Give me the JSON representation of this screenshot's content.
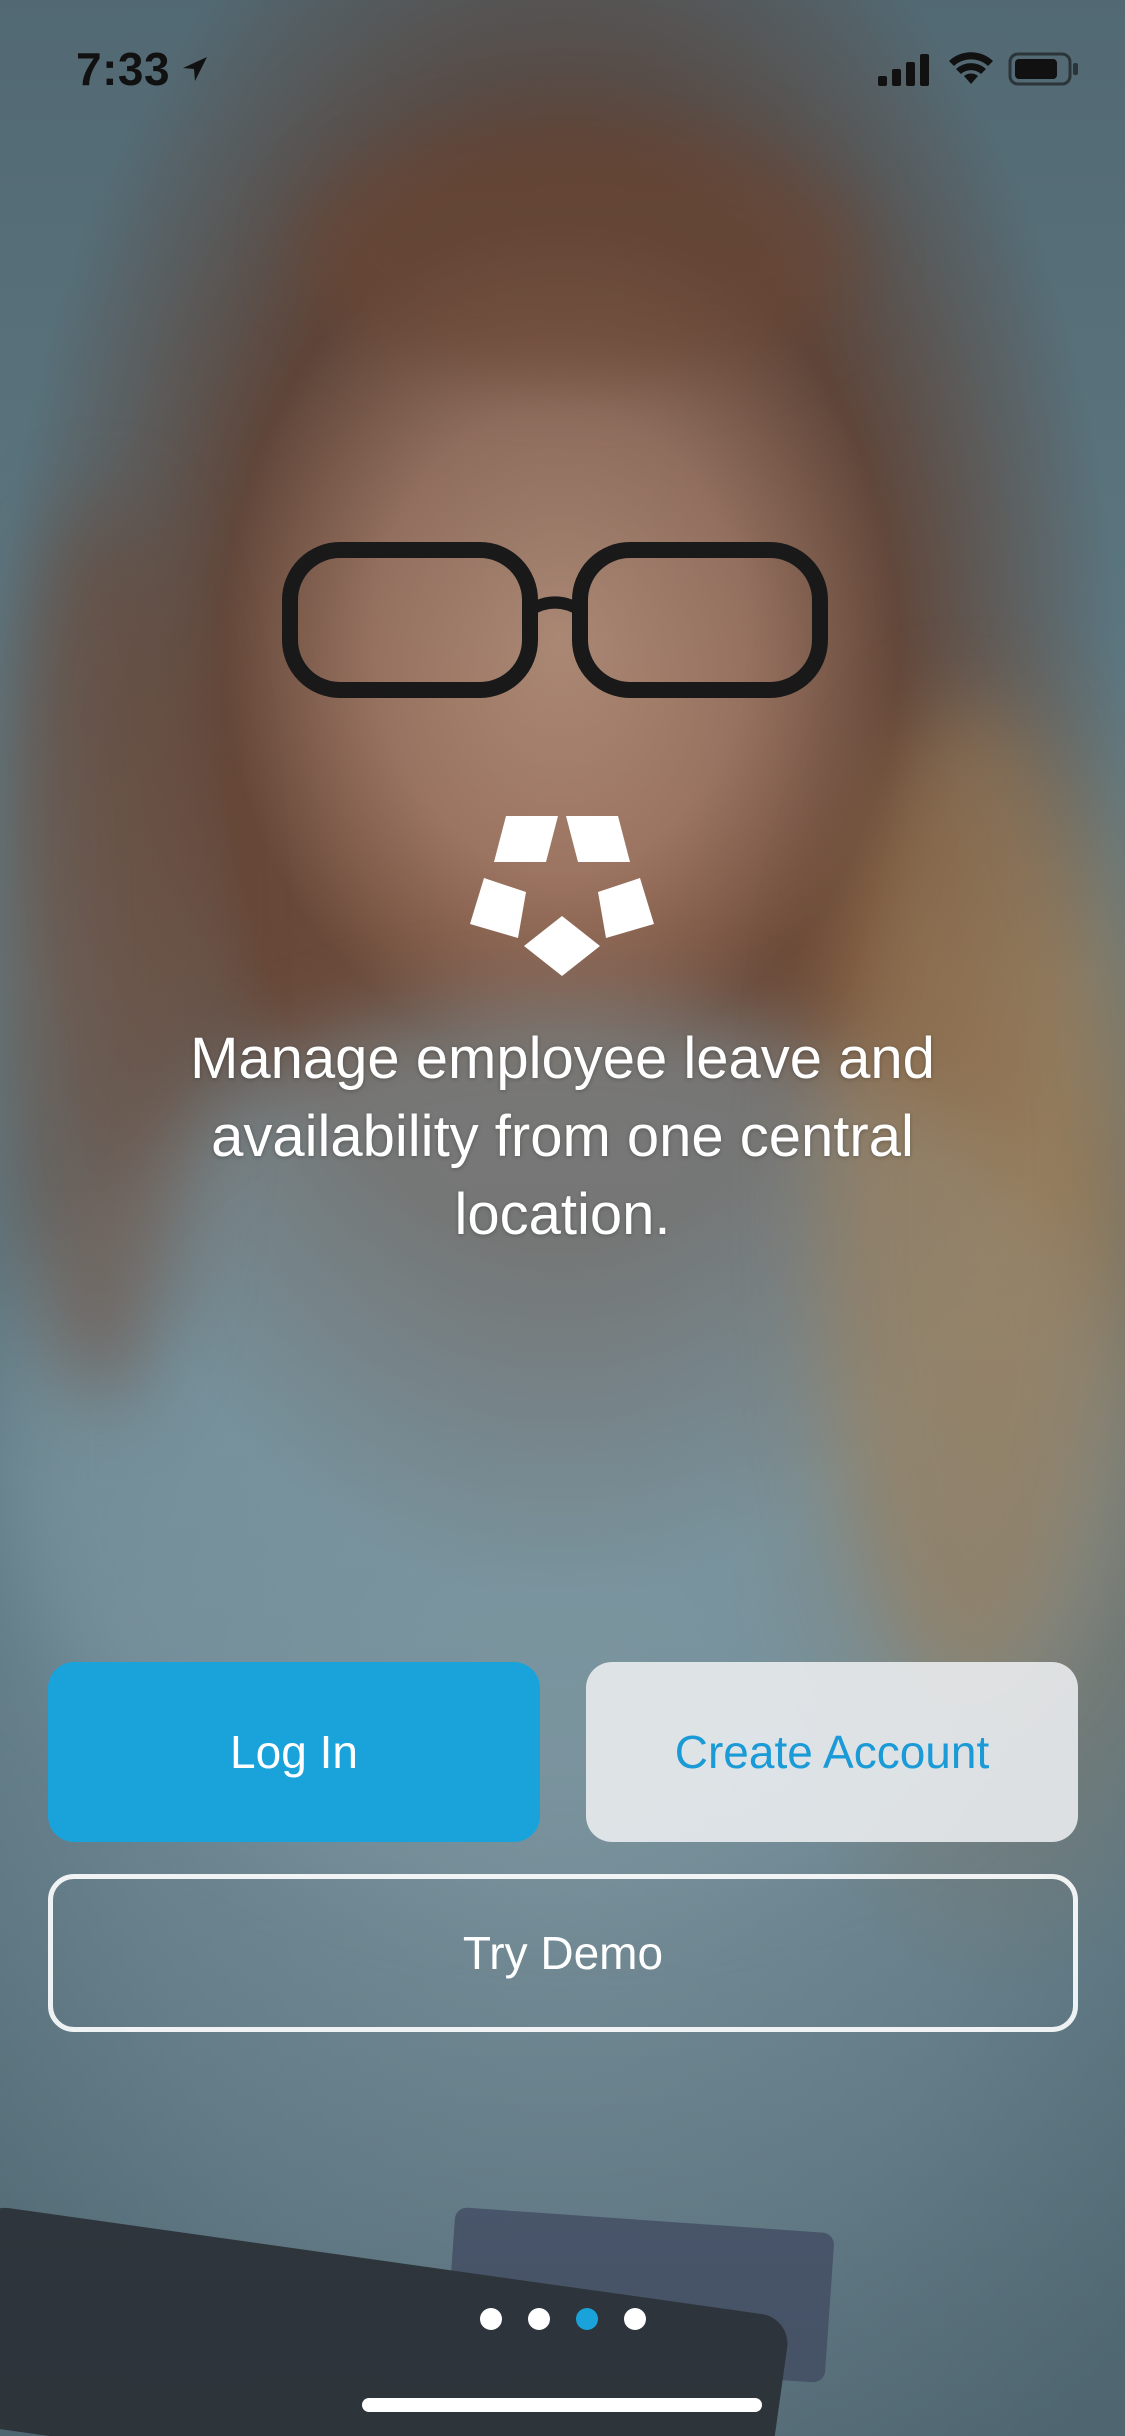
{
  "status_bar": {
    "time": "7:33",
    "location_icon": "location-arrow-icon",
    "signal_icon": "cellular-signal-icon",
    "wifi_icon": "wifi-icon",
    "battery_icon": "battery-icon"
  },
  "brand": {
    "logo_icon": "pentagon-logo-icon",
    "accent_color": "#1aa3da"
  },
  "onboarding": {
    "tagline": "Manage employee leave and availability from one central location.",
    "page_count": 4,
    "active_page": 3
  },
  "actions": {
    "login_label": "Log In",
    "create_account_label": "Create Account",
    "try_demo_label": "Try Demo"
  }
}
